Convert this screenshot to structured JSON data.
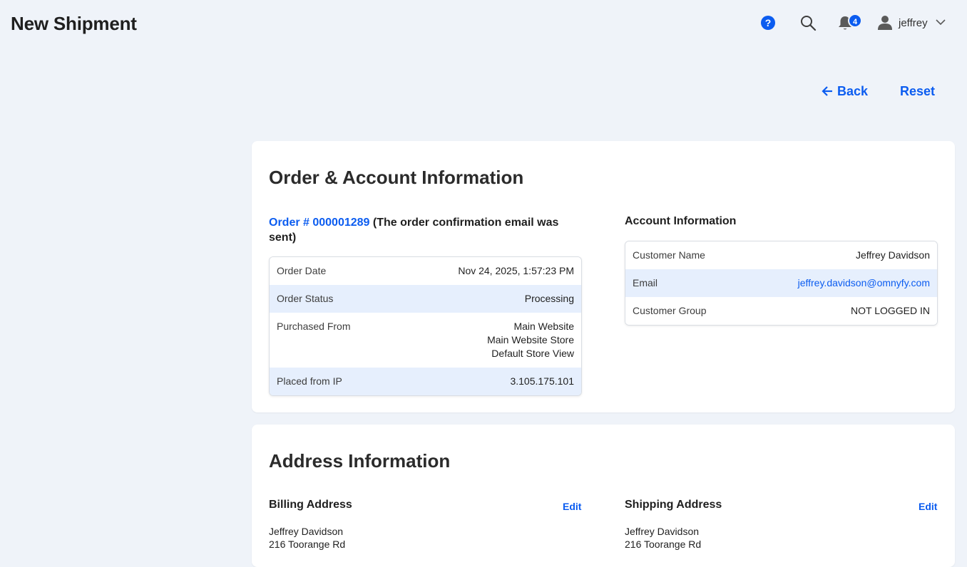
{
  "header": {
    "title": "New Shipment",
    "help_label": "?",
    "notifications_count": "4",
    "user_name": "jeffrey"
  },
  "actions": {
    "back_label": "Back",
    "reset_label": "Reset"
  },
  "order_account": {
    "section_title": "Order & Account Information",
    "order_link": "Order # 000001289",
    "order_note": " (The order confirmation email was sent)",
    "order_rows": [
      {
        "label": "Order Date",
        "value": "Nov 24, 2025, 1:57:23 PM"
      },
      {
        "label": "Order Status",
        "value": "Processing"
      },
      {
        "label": "Purchased From",
        "value_lines": [
          "Main Website",
          "Main Website Store",
          "Default Store View"
        ]
      },
      {
        "label": "Placed from IP",
        "value": "3.105.175.101"
      }
    ],
    "account_title": "Account Information",
    "account_rows": [
      {
        "label": "Customer Name",
        "value": "Jeffrey Davidson"
      },
      {
        "label": "Email",
        "value": "jeffrey.davidson@omnyfy.com"
      },
      {
        "label": "Customer Group",
        "value": "NOT LOGGED IN"
      }
    ]
  },
  "address": {
    "section_title": "Address Information",
    "billing_title": "Billing Address",
    "shipping_title": "Shipping Address",
    "edit_label": "Edit",
    "billing_lines": [
      "Jeffrey Davidson",
      "216 Toorange Rd"
    ],
    "shipping_lines": [
      "Jeffrey Davidson",
      "216 Toorange Rd"
    ]
  },
  "colors": {
    "accent": "#0b5cf0",
    "background": "#eff3f9",
    "row_highlight": "#e6effd"
  },
  "icons": [
    "help-icon",
    "search-icon",
    "bell-icon",
    "user-icon",
    "chevron-down-icon",
    "arrow-left-icon"
  ]
}
